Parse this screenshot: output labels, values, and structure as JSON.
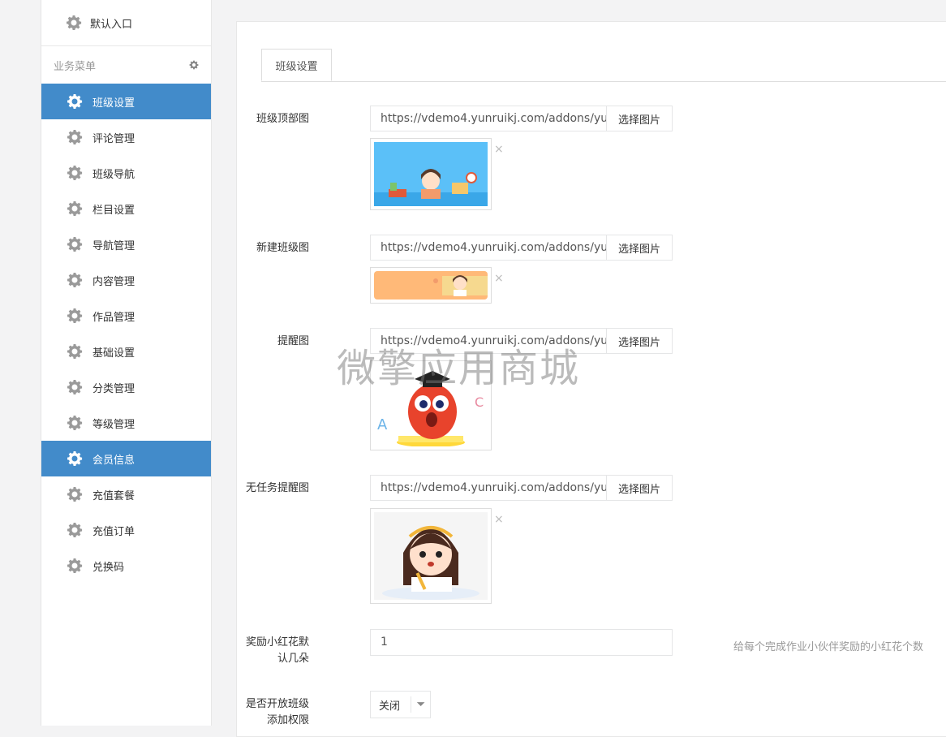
{
  "sidebar": {
    "top_label": "默认入口",
    "section_title": "业务菜单",
    "items": [
      {
        "label": "班级设置",
        "active": true
      },
      {
        "label": "评论管理"
      },
      {
        "label": "班级导航"
      },
      {
        "label": "栏目设置"
      },
      {
        "label": "导航管理"
      },
      {
        "label": "内容管理"
      },
      {
        "label": "作品管理"
      },
      {
        "label": "基础设置"
      },
      {
        "label": "分类管理"
      },
      {
        "label": "等级管理"
      },
      {
        "label": "会员信息",
        "active": true
      },
      {
        "label": "充值套餐"
      },
      {
        "label": "充值订单"
      },
      {
        "label": "兑换码"
      }
    ]
  },
  "main": {
    "tab": "班级设置",
    "fields": [
      {
        "label": "班级顶部图",
        "value": "https://vdemo4.yunruikj.com/addons/yu",
        "button": "选择图片"
      },
      {
        "label": "新建班级图",
        "value": "https://vdemo4.yunruikj.com/addons/yu",
        "button": "选择图片"
      },
      {
        "label": "提醒图",
        "value": "https://vdemo4.yunruikj.com/addons/yu",
        "button": "选择图片"
      },
      {
        "label": "无任务提醒图",
        "value": "https://vdemo4.yunruikj.com/addons/yu",
        "button": "选择图片"
      }
    ],
    "reward": {
      "label": "奖励小红花默认几朵",
      "value": "1",
      "hint": "给每个完成作业小伙伴奖励的小红花个数"
    },
    "permission": {
      "label": "是否开放班级添加权限",
      "selected": "关闭"
    },
    "close_symbol": "×"
  },
  "watermark": "微擎应用商城",
  "colors": {
    "accent": "#428bca",
    "border": "#e5e6e7"
  },
  "icons": {
    "menu": "gear-icon",
    "close": "close-icon",
    "dropdown": "caret-down-icon"
  }
}
